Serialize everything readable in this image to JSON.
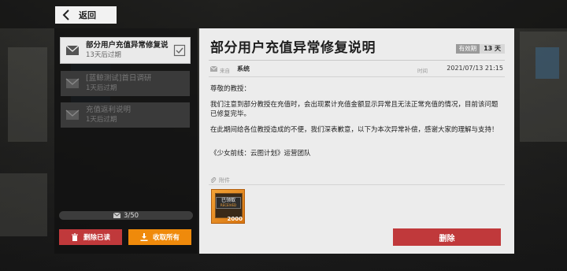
{
  "topbar": {
    "back_label": "返回"
  },
  "mail_list": {
    "items": [
      {
        "title": "部分用户充值异常修复说",
        "subtitle": "13天后过期",
        "state": "active"
      },
      {
        "title": "[蓝鲸测试]首日调研",
        "subtitle": "1天后过期",
        "state": "read"
      },
      {
        "title": "充值返利说明",
        "subtitle": "1天后过期",
        "state": "read"
      }
    ],
    "count": "3/50",
    "delete_read_label": "删除已读",
    "collect_all_label": "收取所有"
  },
  "mail": {
    "title": "部分用户充值异常修复说明",
    "expiry_key": "有效期",
    "expiry_value": "13 天",
    "from_key": "来自",
    "from_value": "系统",
    "time_key": "时间",
    "time_value": "2021/07/13 21:15",
    "greeting": "尊敬的教授：",
    "paragraph1": "我们注意到部分教授在充值时，会出现累计充值金额显示异常且无法正常充值的情况，目前该问题已修复完毕。",
    "paragraph2": "在此期间给各位教授造成的不便，我们深表歉意，以下为本次异常补偿，感谢大家的理解与支持！",
    "signature": "《少女前线：云图计划》运营团队",
    "attachment_label": "附件",
    "attachment": {
      "tag": "已领取",
      "tag_sub": "RECEIVED",
      "quantity": "2000"
    },
    "delete_label": "删除"
  },
  "colors": {
    "danger": "#c0393b",
    "accent": "#ef8a0b"
  },
  "icons": [
    "chevron-left-icon",
    "envelope-icon",
    "check-icon",
    "trash-icon",
    "download-icon",
    "paperclip-icon"
  ]
}
